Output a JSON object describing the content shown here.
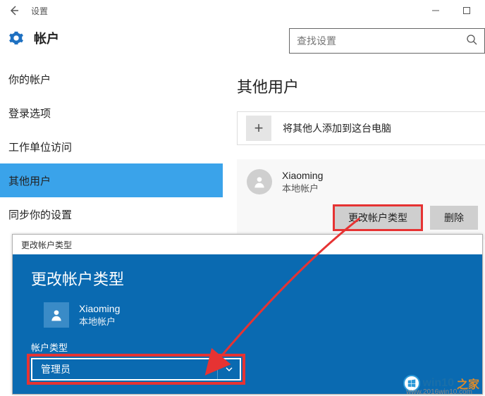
{
  "titlebar": {
    "title": "设置"
  },
  "header": {
    "title": "帐户",
    "search_placeholder": "查找设置"
  },
  "sidebar": {
    "items": [
      {
        "label": "你的帐户"
      },
      {
        "label": "登录选项"
      },
      {
        "label": "工作单位访问"
      },
      {
        "label": "其他用户"
      },
      {
        "label": "同步你的设置"
      }
    ],
    "selected_index": 3
  },
  "content": {
    "title": "其他用户",
    "add_user_text": "将其他人添加到这台电脑",
    "user": {
      "name": "Xiaoming",
      "subtitle": "本地帐户"
    },
    "buttons": {
      "change_type": "更改帐户类型",
      "remove": "删除"
    }
  },
  "dialog": {
    "caption": "更改帐户类型",
    "title": "更改帐户类型",
    "user": {
      "name": "Xiaoming",
      "subtitle": "本地帐户"
    },
    "field_label": "帐户类型",
    "selected_option": "管理员"
  },
  "watermark": {
    "brand1": "win10",
    "brand2": "之家",
    "url": "www.2016win10.com"
  }
}
